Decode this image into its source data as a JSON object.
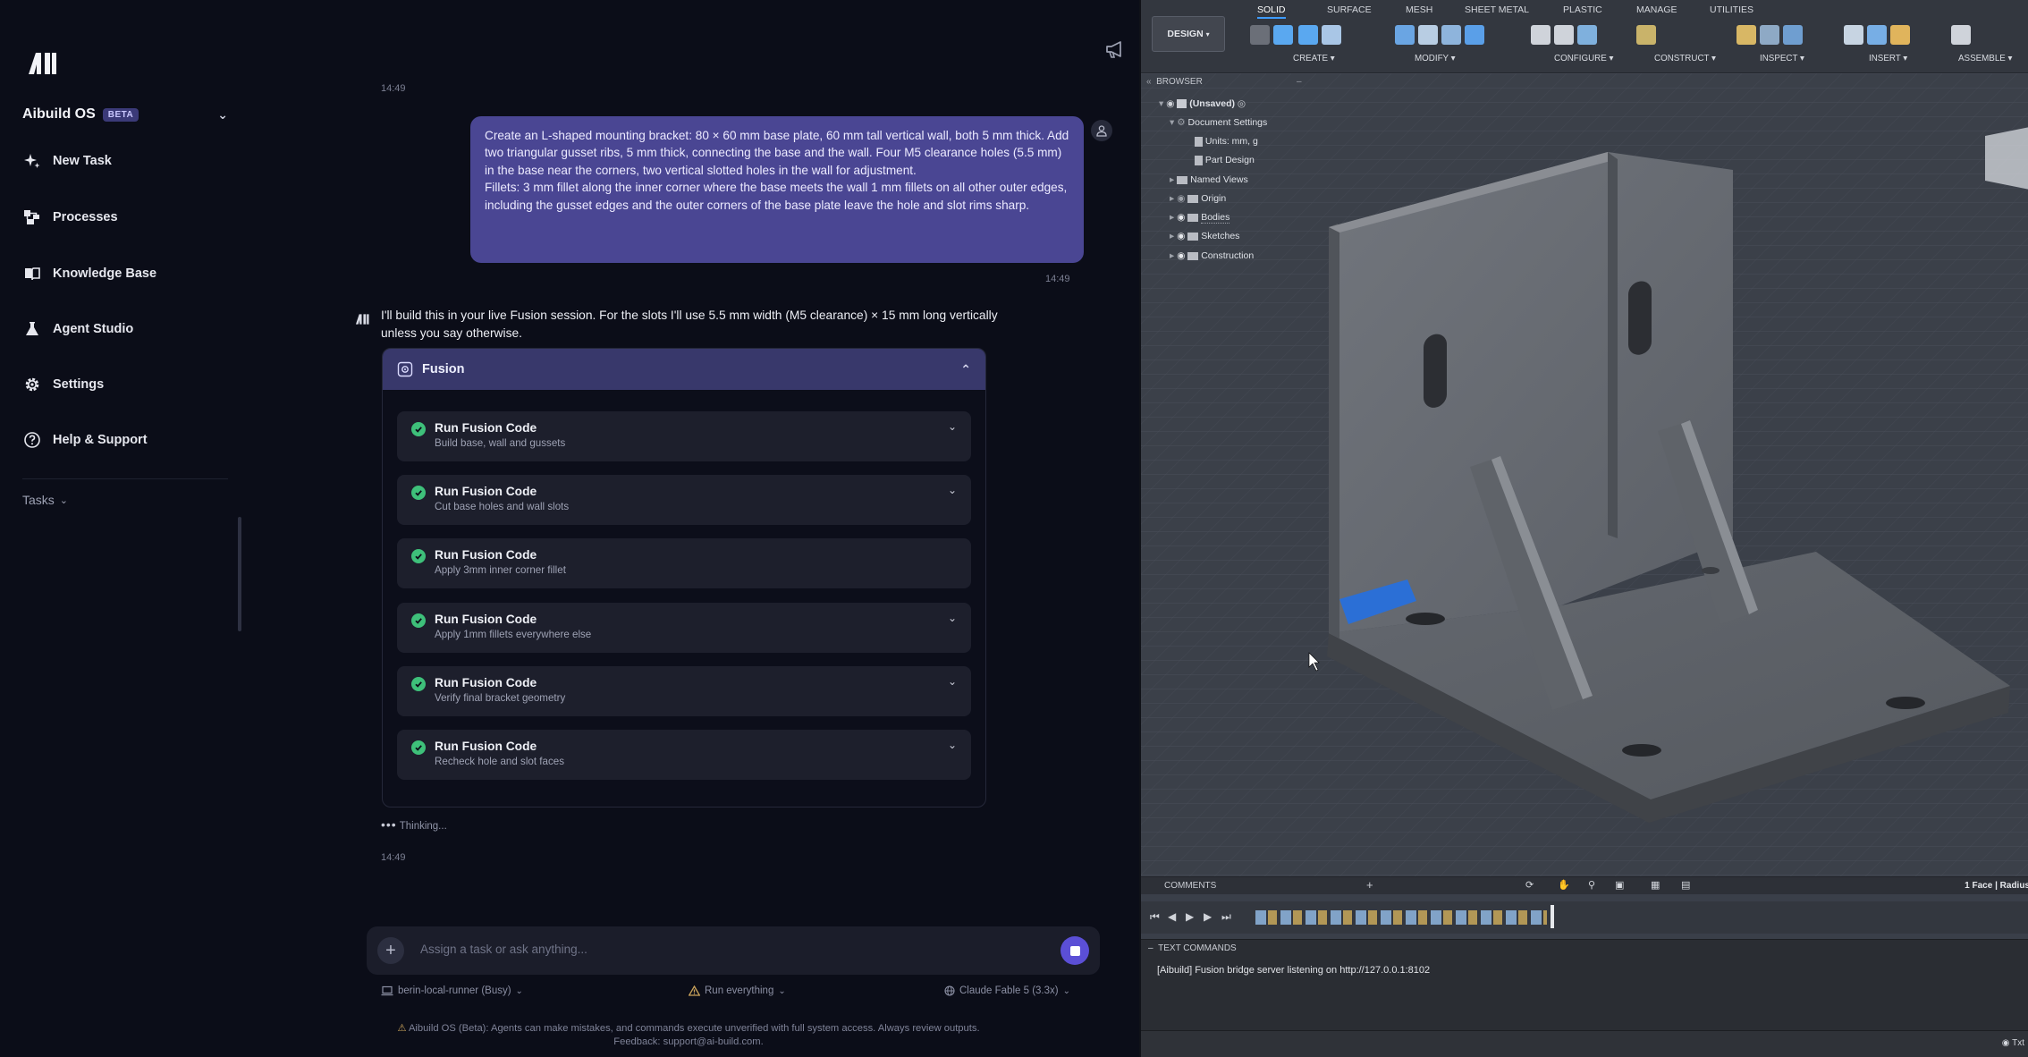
{
  "sidebar": {
    "workspace_name": "Aibuild OS",
    "beta_badge": "BETA",
    "nav": [
      {
        "label": "New Task",
        "icon": "sparkle-icon"
      },
      {
        "label": "Processes",
        "icon": "processes-icon"
      },
      {
        "label": "Knowledge Base",
        "icon": "book-icon"
      },
      {
        "label": "Agent Studio",
        "icon": "flask-icon"
      },
      {
        "label": "Settings",
        "icon": "gear-icon"
      },
      {
        "label": "Help & Support",
        "icon": "help-icon"
      }
    ],
    "tasks_label": "Tasks"
  },
  "chat": {
    "timestamp_top": "14:49",
    "user_message": {
      "para1": "Create an L-shaped mounting bracket: 80 × 60 mm base plate, 60 mm tall vertical wall, both 5 mm thick. Add two triangular gusset ribs, 5 mm thick, connecting the base and the wall. Four M5 clearance holes (5.5 mm) in the base near the corners, two vertical slotted holes in the wall for adjustment.",
      "para2": "Fillets: 3 mm fillet along the inner corner where the base meets the wall 1 mm fillets on all other outer edges, including the gusset edges and the outer corners of the base plate leave the hole and slot rims sharp.",
      "timestamp": "14:49"
    },
    "assistant_message": "I'll build this in your live Fusion session. For the slots I'll use 5.5 mm width (M5 clearance) × 15 mm long vertically unless you say otherwise.",
    "tool_card": {
      "title": "Fusion",
      "steps": [
        {
          "title": "Run Fusion Code",
          "subtitle": "Build base, wall and gussets",
          "expandable": true
        },
        {
          "title": "Run Fusion Code",
          "subtitle": "Cut base holes and wall slots",
          "expandable": true
        },
        {
          "title": "Run Fusion Code",
          "subtitle": "Apply 3mm inner corner fillet",
          "expandable": false
        },
        {
          "title": "Run Fusion Code",
          "subtitle": "Apply 1mm fillets everywhere else",
          "expandable": true
        },
        {
          "title": "Run Fusion Code",
          "subtitle": "Verify final bracket geometry",
          "expandable": true
        },
        {
          "title": "Run Fusion Code",
          "subtitle": "Recheck hole and slot faces",
          "expandable": true
        }
      ]
    },
    "thinking": "Thinking...",
    "timestamp_bottom": "14:49",
    "input_placeholder": "Assign a task or ask anything...",
    "footer": {
      "runner": "berin-local-runner (Busy)",
      "permission": "Run everything",
      "model": "Claude Fable 5 (3.3x)",
      "disclaimer": "Aibuild OS (Beta): Agents can make mistakes, and commands execute unverified with full system access. Always review outputs.",
      "feedback": "Feedback: support@ai-build.com."
    }
  },
  "fusion": {
    "workspace_button": "DESIGN",
    "tabs": [
      "SOLID",
      "SURFACE",
      "MESH",
      "SHEET METAL",
      "PLASTIC",
      "MANAGE",
      "UTILITIES"
    ],
    "active_tab": "SOLID",
    "groups": [
      "CREATE",
      "MODIFY",
      "CONFIGURE",
      "CONSTRUCT",
      "INSPECT",
      "INSERT",
      "ASSEMBLE"
    ],
    "browser_title": "BROWSER",
    "tree": {
      "root": "(Unsaved)",
      "document_settings": "Document Settings",
      "units": "Units: mm, g",
      "part_design": "Part Design",
      "named_views": "Named Views",
      "origin": "Origin",
      "bodies": "Bodies",
      "sketches": "Sketches",
      "construction": "Construction"
    },
    "comments": "COMMENTS",
    "selection_status": "1 Face | Radius",
    "text_commands_title": "TEXT COMMANDS",
    "text_commands_output": "[Aibuild] Fusion bridge server listening on http://127.0.0.1:8102",
    "txt_label": "Txt",
    "colors": {
      "accent": "#3f9cff",
      "highlight_face": "#2b6fd6",
      "model": "#6b6f76"
    }
  }
}
